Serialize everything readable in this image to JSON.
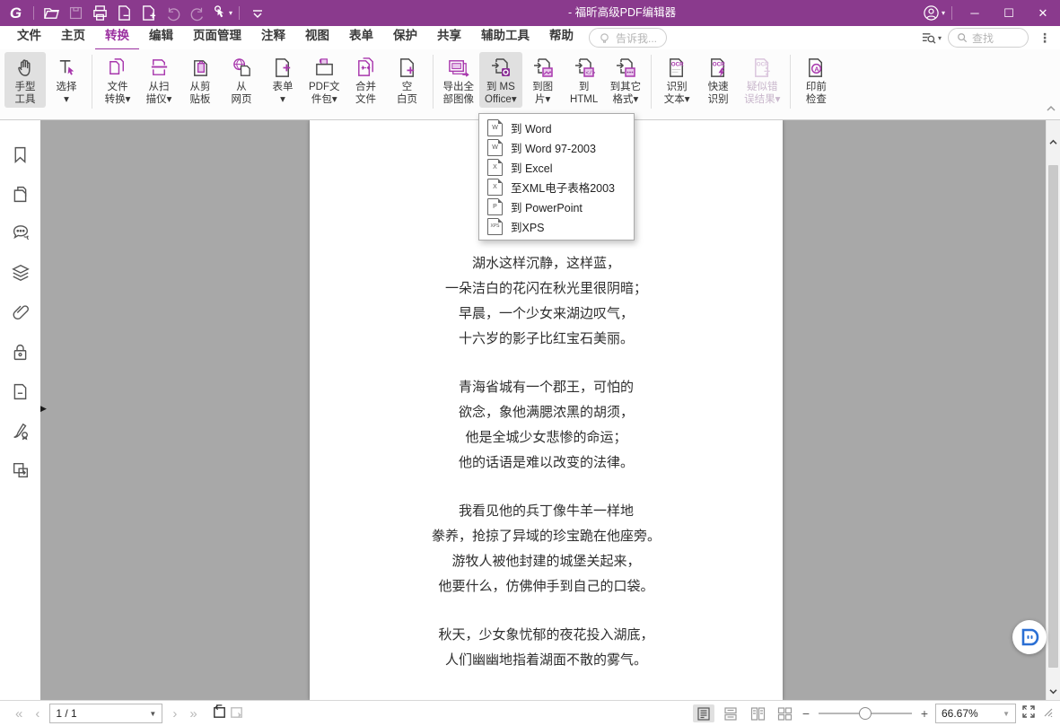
{
  "colors": {
    "titlebar": "#8a3a8d",
    "accent": "#9b30a0",
    "icon_purple": "#a837ad",
    "doc_bg": "#a8a8a8"
  },
  "titlebar": {
    "title": "- 福昕高级PDF编辑器"
  },
  "menu": {
    "tabs": [
      "文件",
      "主页",
      "转换",
      "编辑",
      "页面管理",
      "注释",
      "视图",
      "表单",
      "保护",
      "共享",
      "辅助工具",
      "帮助"
    ],
    "active_tab": "转换",
    "tell_me": "告诉我...",
    "find_placeholder": "查找"
  },
  "ribbon": {
    "buttons": [
      {
        "name": "hand-tool",
        "line1": "手型",
        "line2": "工具",
        "state": "selected"
      },
      {
        "name": "select",
        "line1": "选择",
        "line2": "▾",
        "state": "normal"
      },
      {
        "name": "file-convert",
        "line1": "文件",
        "line2": "转换▾",
        "state": "normal"
      },
      {
        "name": "from-scanner",
        "line1": "从扫",
        "line2": "描仪▾",
        "state": "normal"
      },
      {
        "name": "from-clipboard",
        "line1": "从剪",
        "line2": "贴板",
        "state": "normal"
      },
      {
        "name": "from-web",
        "line1": "从",
        "line2": "网页",
        "state": "normal"
      },
      {
        "name": "form",
        "line1": "表单",
        "line2": "▾",
        "state": "normal"
      },
      {
        "name": "pdf-portfolio",
        "line1": "PDF文",
        "line2": "件包▾",
        "state": "normal"
      },
      {
        "name": "combine-files",
        "line1": "合并",
        "line2": "文件",
        "state": "normal"
      },
      {
        "name": "blank-page",
        "line1": "空",
        "line2": "白页",
        "state": "normal"
      },
      {
        "name": "export-all-images",
        "line1": "导出全",
        "line2": "部图像",
        "state": "normal"
      },
      {
        "name": "to-ms-office",
        "line1": "到 MS",
        "line2": "Office▾",
        "state": "selected"
      },
      {
        "name": "to-image",
        "line1": "到图",
        "line2": "片▾",
        "state": "normal"
      },
      {
        "name": "to-html",
        "line1": "到",
        "line2": "HTML",
        "state": "normal"
      },
      {
        "name": "to-other-format",
        "line1": "到其它",
        "line2": "格式▾",
        "state": "normal"
      },
      {
        "name": "ocr-recognize-text",
        "line1": "识别",
        "line2": "文本▾",
        "state": "normal"
      },
      {
        "name": "quick-ocr",
        "line1": "快速",
        "line2": "识别",
        "state": "normal"
      },
      {
        "name": "ocr-suspects",
        "line1": "疑似错",
        "line2": "误结果▾",
        "state": "disabled"
      },
      {
        "name": "preflight",
        "line1": "印前",
        "line2": "检查",
        "state": "normal"
      }
    ]
  },
  "dropdown": {
    "items": [
      {
        "icon_letter": "W",
        "label": "到 Word"
      },
      {
        "icon_letter": "W",
        "label": "到 Word 97-2003"
      },
      {
        "icon_letter": "X",
        "label": "到 Excel"
      },
      {
        "icon_letter": "X",
        "label": "至XML电子表格2003"
      },
      {
        "icon_letter": "P",
        "label": "到 PowerPoint"
      },
      {
        "icon_letter": "XPS",
        "label": "到XPS"
      }
    ]
  },
  "document": {
    "stanzas": [
      [
        "湖水这样沉静，这样蓝，",
        "一朵洁白的花闪在秋光里很阴暗；",
        "早晨，一个少女来湖边叹气，",
        "十六岁的影子比红宝石美丽。"
      ],
      [
        "青海省城有一个郡王，可怕的",
        "欲念，象他满腮浓黑的胡须，",
        "他是全城少女悲惨的命运；",
        "他的话语是难以改变的法律。"
      ],
      [
        "我看见他的兵丁像牛羊一样地",
        "豢养，抢掠了异域的珍宝跪在他座旁。",
        "游牧人被他封建的城堡关起来，",
        "他要什么，仿佛伸手到自己的口袋。"
      ],
      [
        "秋天，少女象忧郁的夜花投入湖底，",
        "人们幽幽地指着湖面不散的雾气。"
      ]
    ]
  },
  "statusbar": {
    "page_indicator": "1 / 1",
    "zoom_value": "66.67%"
  }
}
